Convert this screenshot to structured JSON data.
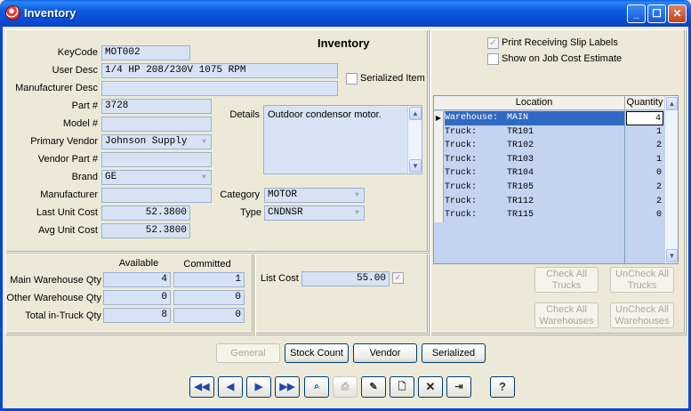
{
  "window": {
    "title": "Inventory"
  },
  "form": {
    "heading": "Inventory",
    "keycode": {
      "label": "KeyCode",
      "value": "MOT002"
    },
    "user_desc": {
      "label": "User Desc",
      "value": "1/4 HP 208/230V 1075 RPM"
    },
    "manufacturer_desc": {
      "label": "Manufacturer Desc",
      "value": ""
    },
    "serialized": {
      "label": "Serialized Item"
    },
    "part": {
      "label": "Part #",
      "value": "3728"
    },
    "model": {
      "label": "Model #",
      "value": ""
    },
    "primary_vendor": {
      "label": "Primary Vendor",
      "value": "Johnson Supply"
    },
    "vendor_part": {
      "label": "Vendor Part #",
      "value": ""
    },
    "brand": {
      "label": "Brand",
      "value": "GE"
    },
    "manufacturer": {
      "label": "Manufacturer",
      "value": ""
    },
    "last_unit_cost": {
      "label": "Last Unit Cost",
      "value": "52.3800"
    },
    "avg_unit_cost": {
      "label": "Avg Unit Cost",
      "value": "52.3800"
    },
    "details": {
      "label": "Details",
      "value": "Outdoor condensor motor."
    },
    "category": {
      "label": "Category",
      "value": "MOTOR"
    },
    "type": {
      "label": "Type",
      "value": "CNDNSR"
    }
  },
  "options": {
    "print_receiving": {
      "label": "Print Receiving Slip Labels",
      "checked": "✓"
    },
    "show_job_cost": {
      "label": "Show on Job Cost Estimate"
    }
  },
  "qty": {
    "col_available": "Available",
    "col_committed": "Committed",
    "rows": [
      {
        "label": "Main Warehouse Qty",
        "available": "4",
        "committed": "1"
      },
      {
        "label": "Other Warehouse Qty",
        "available": "0",
        "committed": "0"
      },
      {
        "label": "Total in-Truck Qty",
        "available": "8",
        "committed": "0"
      }
    ],
    "list_cost": {
      "label": "List Cost",
      "value": "55.00",
      "check": "✓"
    }
  },
  "locations": {
    "col_location": "Location",
    "col_quantity": "Quantity",
    "rows": [
      {
        "type": "Warehouse:",
        "name": "MAIN",
        "qty": "4"
      },
      {
        "type": "Truck:",
        "name": "TR101",
        "qty": "1"
      },
      {
        "type": "Truck:",
        "name": "TR102",
        "qty": "2"
      },
      {
        "type": "Truck:",
        "name": "TR103",
        "qty": "1"
      },
      {
        "type": "Truck:",
        "name": "TR104",
        "qty": "0"
      },
      {
        "type": "Truck:",
        "name": "TR105",
        "qty": "2"
      },
      {
        "type": "Truck:",
        "name": "TR112",
        "qty": "2"
      },
      {
        "type": "Truck:",
        "name": "TR115",
        "qty": "0"
      }
    ],
    "check_all_trucks": [
      "Check All",
      "Trucks"
    ],
    "uncheck_all_trucks": [
      "UnCheck All",
      "Trucks"
    ],
    "check_all_wh": [
      "Check All",
      "Warehouses"
    ],
    "uncheck_all_wh": [
      "UnCheck All",
      "Warehouses"
    ]
  },
  "tabs": {
    "general": "General",
    "stock_count": "Stock Count",
    "vendor": "Vendor",
    "serialized": "Serialized"
  },
  "toolbar": {
    "first": "◀◀",
    "prev": "◀",
    "next": "▶",
    "last": "▶▶",
    "help": "?"
  }
}
